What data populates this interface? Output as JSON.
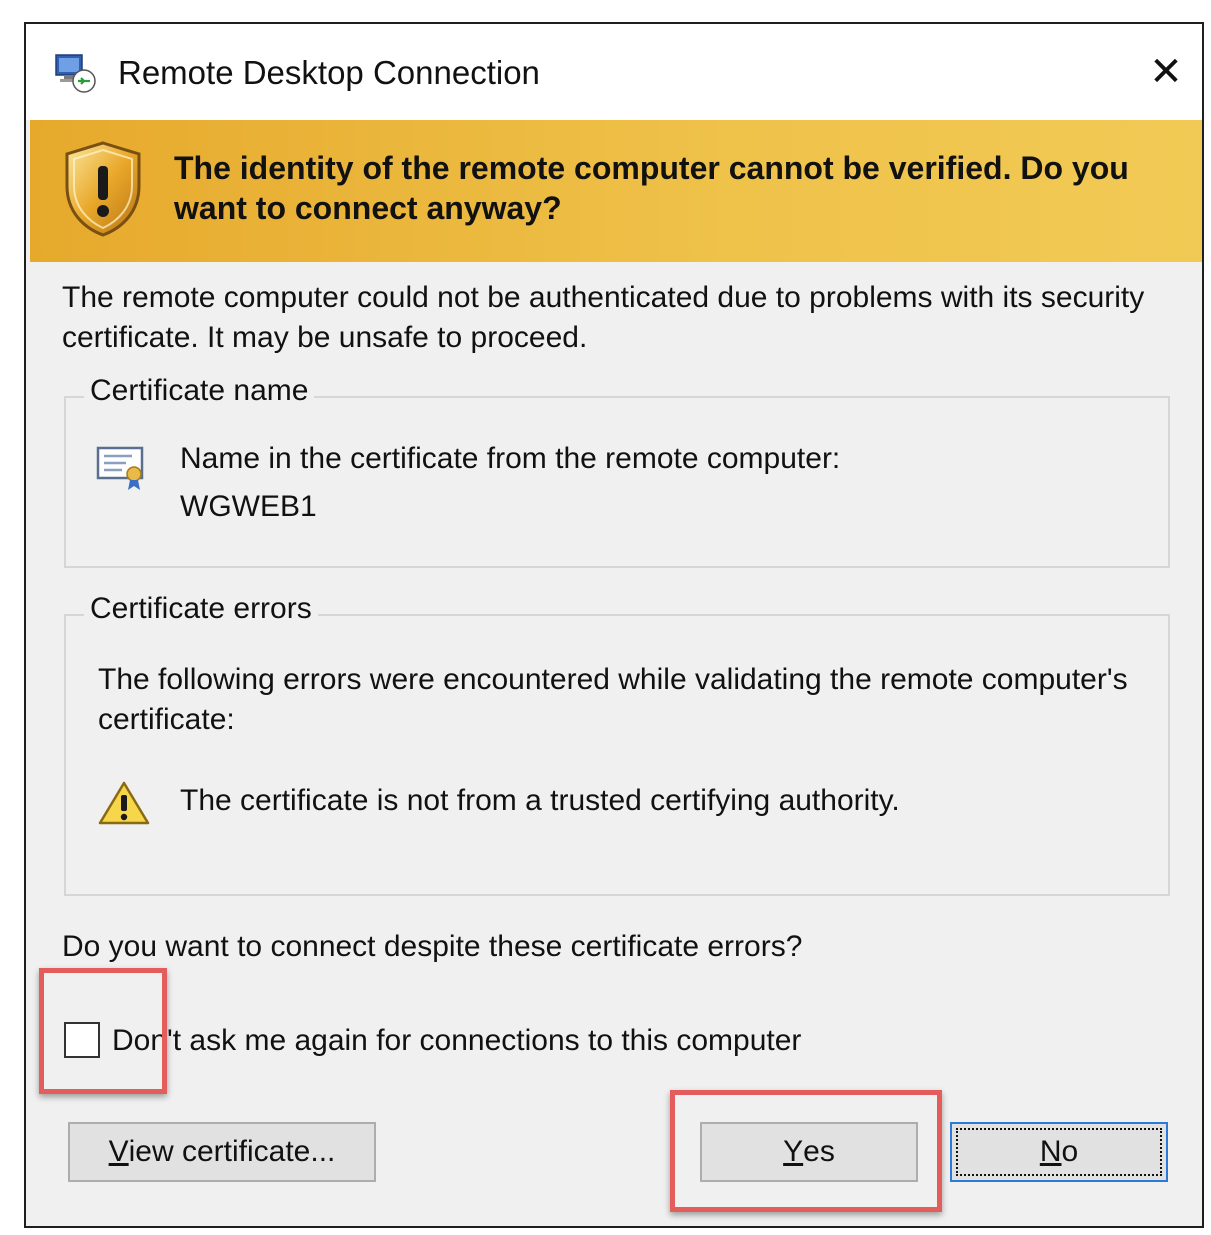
{
  "window": {
    "title": "Remote Desktop Connection",
    "close_glyph": "✕",
    "app_icon": "remote-desktop-icon"
  },
  "banner": {
    "icon": "shield-warning-icon",
    "text": "The identity of the remote computer cannot be verified. Do you want to connect anyway?",
    "color": "#efc24a"
  },
  "intro": "The remote computer could not be authenticated due to problems with its security certificate. It may be unsafe to proceed.",
  "certificate_name": {
    "legend": "Certificate name",
    "icon": "certificate-icon",
    "label": "Name in the certificate from the remote computer:",
    "value": "WGWEB1"
  },
  "certificate_errors": {
    "legend": "Certificate errors",
    "intro": "The following errors were encountered while validating the remote computer's certificate:",
    "icon": "warning-triangle-icon",
    "items": [
      "The certificate is not from a trusted certifying authority."
    ]
  },
  "question": "Do you want to connect despite these certificate errors?",
  "checkbox": {
    "label": "Don't ask me again for connections to this computer",
    "checked": false
  },
  "buttons": {
    "view_certificate": {
      "accel": "V",
      "rest": "iew certificate..."
    },
    "yes": {
      "accel": "Y",
      "rest": "es"
    },
    "no": {
      "accel": "N",
      "rest": "o"
    }
  },
  "highlight_color": "#e35d5d"
}
